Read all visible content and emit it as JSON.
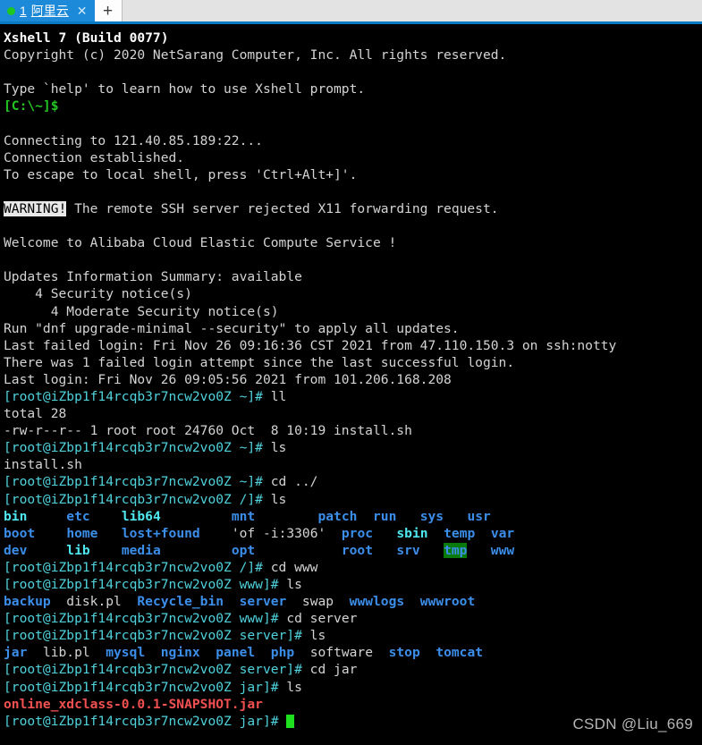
{
  "window": {
    "accent_color": "#0a7ac4",
    "tabbar_bg": "#e3e3e3"
  },
  "tabbar": {
    "tabs": [
      {
        "index_label": "1",
        "title": "阿里云",
        "status_dot": "connected-dot",
        "close_label": "✕",
        "active": true
      }
    ],
    "new_tab_label": "+"
  },
  "watermark": "CSDN @Liu_669",
  "terminal": {
    "cursor": "block-cursor",
    "prompt_host": "[root@iZbp1f14rcqb3r7ncw2vo0Z",
    "lines": [
      {
        "segs": [
          {
            "t": "Xshell 7 (Build 0077)",
            "c": "c-bwhite"
          }
        ]
      },
      {
        "segs": [
          {
            "t": "Copyright (c) 2020 NetSarang Computer, Inc. All rights reserved.",
            "c": "c-white"
          }
        ]
      },
      {
        "segs": [
          {
            "t": "",
            "c": "c-white"
          }
        ]
      },
      {
        "segs": [
          {
            "t": "Type `help' to learn how to use Xshell prompt.",
            "c": "c-white"
          }
        ]
      },
      {
        "segs": [
          {
            "t": "[C:\\~]$",
            "c": "c-green"
          }
        ]
      },
      {
        "segs": [
          {
            "t": "",
            "c": "c-white"
          }
        ]
      },
      {
        "segs": [
          {
            "t": "Connecting to 121.40.85.189:22...",
            "c": "c-white"
          }
        ]
      },
      {
        "segs": [
          {
            "t": "Connection established.",
            "c": "c-white"
          }
        ]
      },
      {
        "segs": [
          {
            "t": "To escape to local shell, press 'Ctrl+Alt+]'.",
            "c": "c-white"
          }
        ]
      },
      {
        "segs": [
          {
            "t": "",
            "c": "c-white"
          }
        ]
      },
      {
        "segs": [
          {
            "t": "WARNING!",
            "c": "c-inv"
          },
          {
            "t": " The remote SSH server rejected X11 forwarding request.",
            "c": "c-white"
          }
        ]
      },
      {
        "segs": [
          {
            "t": "",
            "c": "c-white"
          }
        ]
      },
      {
        "segs": [
          {
            "t": "Welcome to Alibaba Cloud Elastic Compute Service !",
            "c": "c-white"
          }
        ]
      },
      {
        "segs": [
          {
            "t": "",
            "c": "c-white"
          }
        ]
      },
      {
        "segs": [
          {
            "t": "Updates Information Summary: available",
            "c": "c-white"
          }
        ]
      },
      {
        "segs": [
          {
            "t": "    4 Security notice(s)",
            "c": "c-white"
          }
        ]
      },
      {
        "segs": [
          {
            "t": "      4 Moderate Security notice(s)",
            "c": "c-white"
          }
        ]
      },
      {
        "segs": [
          {
            "t": "Run \"dnf upgrade-minimal --security\" to apply all updates.",
            "c": "c-white"
          }
        ]
      },
      {
        "segs": [
          {
            "t": "Last failed login: Fri Nov 26 09:16:36 CST 2021 from 47.110.150.3 on ssh:notty",
            "c": "c-white"
          }
        ]
      },
      {
        "segs": [
          {
            "t": "There was 1 failed login attempt since the last successful login.",
            "c": "c-white"
          }
        ]
      },
      {
        "segs": [
          {
            "t": "Last login: Fri Nov 26 09:05:56 2021 from 101.206.168.208",
            "c": "c-white"
          }
        ]
      },
      {
        "segs": [
          {
            "t": "[root@iZbp1f14rcqb3r7ncw2vo0Z ~]# ",
            "c": "c-cyan"
          },
          {
            "t": "ll",
            "c": "c-white"
          }
        ]
      },
      {
        "segs": [
          {
            "t": "total 28",
            "c": "c-white"
          }
        ]
      },
      {
        "segs": [
          {
            "t": "-rw-r--r-- 1 root root 24760 Oct  8 10:19 install.sh",
            "c": "c-white"
          }
        ]
      },
      {
        "segs": [
          {
            "t": "[root@iZbp1f14rcqb3r7ncw2vo0Z ~]# ",
            "c": "c-cyan"
          },
          {
            "t": "ls",
            "c": "c-white"
          }
        ]
      },
      {
        "segs": [
          {
            "t": "install.sh",
            "c": "c-white"
          }
        ]
      },
      {
        "segs": [
          {
            "t": "[root@iZbp1f14rcqb3r7ncw2vo0Z ~]# ",
            "c": "c-cyan"
          },
          {
            "t": "cd ../",
            "c": "c-white"
          }
        ]
      },
      {
        "segs": [
          {
            "t": "[root@iZbp1f14rcqb3r7ncw2vo0Z /]# ",
            "c": "c-cyan"
          },
          {
            "t": "ls",
            "c": "c-white"
          }
        ]
      },
      {
        "segs": [
          {
            "t": "bin",
            "c": "c-bcyan"
          },
          {
            "t": "     ",
            "c": "c-white"
          },
          {
            "t": "etc",
            "c": "c-blue"
          },
          {
            "t": "    ",
            "c": "c-white"
          },
          {
            "t": "lib64",
            "c": "c-bcyan"
          },
          {
            "t": "         ",
            "c": "c-white"
          },
          {
            "t": "mnt",
            "c": "c-blue"
          },
          {
            "t": "        ",
            "c": "c-white"
          },
          {
            "t": "patch",
            "c": "c-blue"
          },
          {
            "t": "  ",
            "c": "c-white"
          },
          {
            "t": "run",
            "c": "c-blue"
          },
          {
            "t": "   ",
            "c": "c-white"
          },
          {
            "t": "sys",
            "c": "c-blue"
          },
          {
            "t": "   ",
            "c": "c-white"
          },
          {
            "t": "usr",
            "c": "c-blue"
          }
        ]
      },
      {
        "segs": [
          {
            "t": "boot",
            "c": "c-blue"
          },
          {
            "t": "    ",
            "c": "c-white"
          },
          {
            "t": "home",
            "c": "c-blue"
          },
          {
            "t": "   ",
            "c": "c-white"
          },
          {
            "t": "lost+found",
            "c": "c-blue"
          },
          {
            "t": "    ",
            "c": "c-white"
          },
          {
            "t": "'of -i:3306'",
            "c": "c-white"
          },
          {
            "t": "  ",
            "c": "c-white"
          },
          {
            "t": "proc",
            "c": "c-blue"
          },
          {
            "t": "   ",
            "c": "c-white"
          },
          {
            "t": "sbin",
            "c": "c-bcyan"
          },
          {
            "t": "  ",
            "c": "c-white"
          },
          {
            "t": "temp",
            "c": "c-blue"
          },
          {
            "t": "  ",
            "c": "c-white"
          },
          {
            "t": "var",
            "c": "c-blue"
          }
        ]
      },
      {
        "segs": [
          {
            "t": "dev",
            "c": "c-blue"
          },
          {
            "t": "     ",
            "c": "c-white"
          },
          {
            "t": "lib",
            "c": "c-bcyan"
          },
          {
            "t": "    ",
            "c": "c-white"
          },
          {
            "t": "media",
            "c": "c-blue"
          },
          {
            "t": "         ",
            "c": "c-white"
          },
          {
            "t": "opt",
            "c": "c-blue"
          },
          {
            "t": "           ",
            "c": "c-white"
          },
          {
            "t": "root",
            "c": "c-blue"
          },
          {
            "t": "   ",
            "c": "c-white"
          },
          {
            "t": "srv",
            "c": "c-blue"
          },
          {
            "t": "   ",
            "c": "c-white"
          },
          {
            "t": "tmp",
            "c": "c-stickydir"
          },
          {
            "t": "   ",
            "c": "c-white"
          },
          {
            "t": "www",
            "c": "c-blue"
          }
        ]
      },
      {
        "segs": [
          {
            "t": "[root@iZbp1f14rcqb3r7ncw2vo0Z /]# ",
            "c": "c-cyan"
          },
          {
            "t": "cd www",
            "c": "c-white"
          }
        ]
      },
      {
        "segs": [
          {
            "t": "[root@iZbp1f14rcqb3r7ncw2vo0Z www]# ",
            "c": "c-cyan"
          },
          {
            "t": "ls",
            "c": "c-white"
          }
        ]
      },
      {
        "segs": [
          {
            "t": "backup",
            "c": "c-blue"
          },
          {
            "t": "  ",
            "c": "c-white"
          },
          {
            "t": "disk.pl",
            "c": "c-white"
          },
          {
            "t": "  ",
            "c": "c-white"
          },
          {
            "t": "Recycle_bin",
            "c": "c-blue"
          },
          {
            "t": "  ",
            "c": "c-white"
          },
          {
            "t": "server",
            "c": "c-blue"
          },
          {
            "t": "  ",
            "c": "c-white"
          },
          {
            "t": "swap",
            "c": "c-white"
          },
          {
            "t": "  ",
            "c": "c-white"
          },
          {
            "t": "wwwlogs",
            "c": "c-blue"
          },
          {
            "t": "  ",
            "c": "c-white"
          },
          {
            "t": "wwwroot",
            "c": "c-blue"
          }
        ]
      },
      {
        "segs": [
          {
            "t": "[root@iZbp1f14rcqb3r7ncw2vo0Z www]# ",
            "c": "c-cyan"
          },
          {
            "t": "cd server",
            "c": "c-white"
          }
        ]
      },
      {
        "segs": [
          {
            "t": "[root@iZbp1f14rcqb3r7ncw2vo0Z server]# ",
            "c": "c-cyan"
          },
          {
            "t": "ls",
            "c": "c-white"
          }
        ]
      },
      {
        "segs": [
          {
            "t": "jar",
            "c": "c-blue"
          },
          {
            "t": "  ",
            "c": "c-white"
          },
          {
            "t": "lib.pl",
            "c": "c-white"
          },
          {
            "t": "  ",
            "c": "c-white"
          },
          {
            "t": "mysql",
            "c": "c-blue"
          },
          {
            "t": "  ",
            "c": "c-white"
          },
          {
            "t": "nginx",
            "c": "c-blue"
          },
          {
            "t": "  ",
            "c": "c-white"
          },
          {
            "t": "panel",
            "c": "c-blue"
          },
          {
            "t": "  ",
            "c": "c-white"
          },
          {
            "t": "php",
            "c": "c-blue"
          },
          {
            "t": "  ",
            "c": "c-white"
          },
          {
            "t": "software",
            "c": "c-white"
          },
          {
            "t": "  ",
            "c": "c-white"
          },
          {
            "t": "stop",
            "c": "c-blue"
          },
          {
            "t": "  ",
            "c": "c-white"
          },
          {
            "t": "tomcat",
            "c": "c-blue"
          }
        ]
      },
      {
        "segs": [
          {
            "t": "[root@iZbp1f14rcqb3r7ncw2vo0Z server]# ",
            "c": "c-cyan"
          },
          {
            "t": "cd jar",
            "c": "c-white"
          }
        ]
      },
      {
        "segs": [
          {
            "t": "[root@iZbp1f14rcqb3r7ncw2vo0Z jar]# ",
            "c": "c-cyan"
          },
          {
            "t": "ls",
            "c": "c-white"
          }
        ]
      },
      {
        "segs": [
          {
            "t": "online_xdclass-0.0.1-SNAPSHOT.jar",
            "c": "c-red"
          }
        ]
      },
      {
        "segs": [
          {
            "t": "[root@iZbp1f14rcqb3r7ncw2vo0Z jar]# ",
            "c": "c-cyan"
          },
          {
            "t": "",
            "c": "c-white",
            "cursor": true
          }
        ]
      }
    ]
  }
}
